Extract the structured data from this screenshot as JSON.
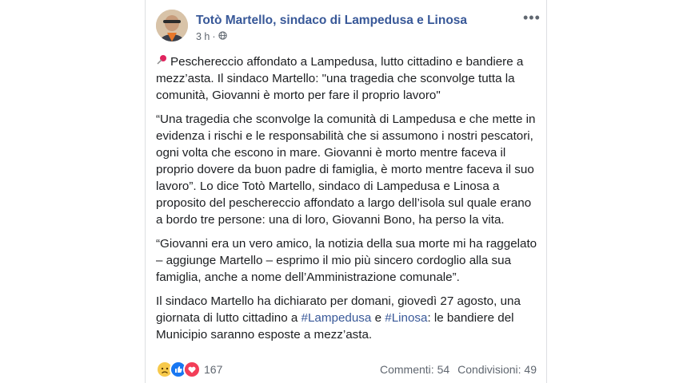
{
  "post": {
    "author": "Totò Martello, sindaco di Lampedusa e Linosa",
    "time": "3 h",
    "paragraphs": {
      "p1": "Peschereccio affondato a Lampedusa, lutto cittadino e bandiere a mezz’asta. Il sindaco Martello: \"una tragedia che sconvolge tutta la comunità, Giovanni è morto per fare il proprio lavoro\"",
      "p2": "“Una tragedia che sconvolge la comunità di Lampedusa e che mette in evidenza i rischi e le responsabilità che si assumono i nostri pescatori, ogni volta che escono in mare. Giovanni è morto mentre faceva il proprio dovere da buon padre di famiglia, è morto mentre faceva il suo lavoro”. Lo dice Totò Martello, sindaco di Lampedusa e Linosa a proposito del peschereccio affondato a largo dell’isola sul quale erano a bordo tre persone: una di loro, Giovanni Bono, ha perso la vita.",
      "p3": "“Giovanni era un vero amico, la notizia della sua morte mi ha raggelato – aggiunge Martello – esprimo il mio più sincero cordoglio alla sua famiglia, anche a nome dell’Amministrazione comunale”.",
      "p4_pre": "Il sindaco Martello ha dichiarato per domani, giovedì 27 agosto, una giornata di lutto cittadino a ",
      "p4_tag1": "#Lampedusa",
      "p4_mid": " e ",
      "p4_tag2": "#Linosa",
      "p4_post": ": le bandiere del Municipio saranno esposte a mezz’asta."
    },
    "reactions_count": "167",
    "comments": "Commenti: 54",
    "shares": "Condivisioni: 49"
  },
  "icons": [
    "pushpin-icon",
    "globe-icon",
    "more-options-icon",
    "sad-reaction-icon",
    "like-reaction-icon",
    "love-reaction-icon"
  ],
  "colors": {
    "link": "#385898",
    "muted": "#606770"
  }
}
